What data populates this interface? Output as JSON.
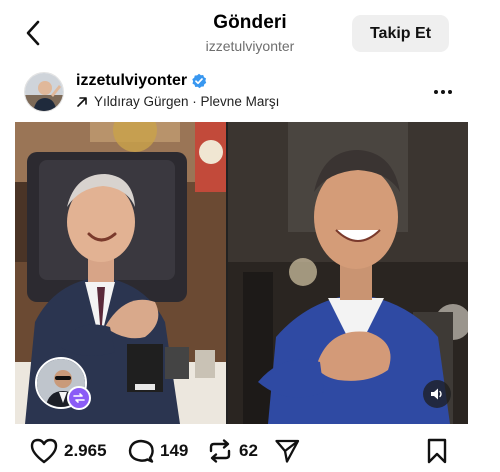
{
  "header": {
    "title": "Gönderi",
    "subtitle": "izzetulviyonter",
    "follow_label": "Takip Et"
  },
  "post": {
    "username": "izzetulviyonter",
    "verified": true,
    "audio": "Yıldıray Gürgen · Plevne Marşı"
  },
  "actions": {
    "likes": "2.965",
    "comments": "149",
    "reposts": "62"
  },
  "icons": {
    "back": "chevron-left-icon",
    "verified": "verified-badge-icon",
    "audio": "arrow-up-right-icon",
    "more": "more-horizontal-icon",
    "like": "heart-icon",
    "comment": "comment-icon",
    "repost": "repost-icon",
    "share": "send-icon",
    "save": "bookmark-icon",
    "sound": "speaker-icon",
    "remix": "remix-icon"
  },
  "colors": {
    "verified": "#3897f0",
    "follow_bg": "#efefef",
    "remix_badge": "#8b5cf6"
  }
}
